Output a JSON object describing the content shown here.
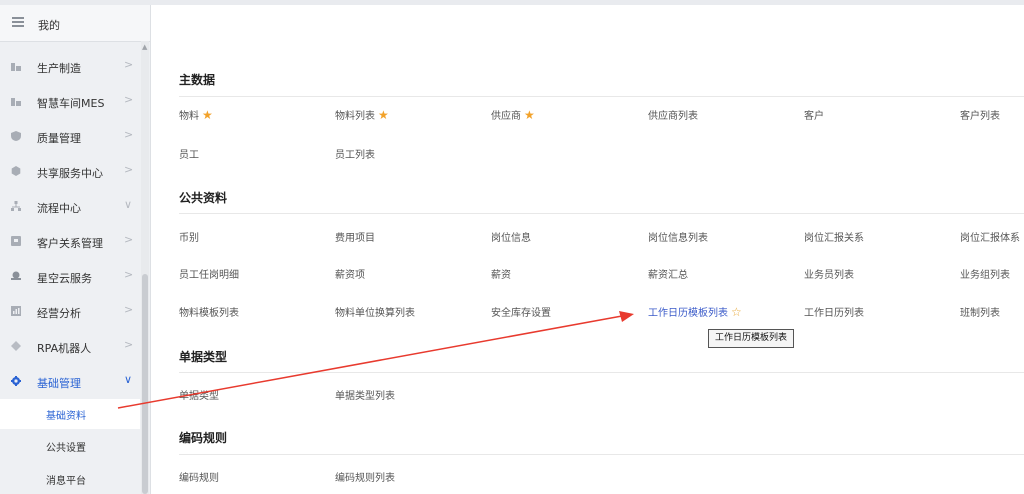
{
  "sidebar": {
    "header": {
      "label": "我的"
    },
    "items": [
      {
        "label": "生产制造",
        "chevron": ">"
      },
      {
        "label": "智慧车间MES",
        "chevron": ">"
      },
      {
        "label": "质量管理",
        "chevron": ">"
      },
      {
        "label": "共享服务中心",
        "chevron": ">"
      },
      {
        "label": "流程中心",
        "chevron": "∨"
      },
      {
        "label": "客户关系管理",
        "chevron": ">"
      },
      {
        "label": "星空云服务",
        "chevron": ">"
      },
      {
        "label": "经营分析",
        "chevron": ">"
      },
      {
        "label": "RPA机器人",
        "chevron": ">"
      },
      {
        "label": "基础管理",
        "chevron": "∨"
      }
    ],
    "sub_items": [
      {
        "label": "基础资料"
      },
      {
        "label": "公共设置"
      },
      {
        "label": "消息平台"
      }
    ]
  },
  "sections": {
    "master": {
      "title": "主数据",
      "links": [
        "物料",
        "物料列表",
        "供应商",
        "供应商列表",
        "客户",
        "客户列表",
        "员工",
        "员工列表"
      ]
    },
    "public": {
      "title": "公共资料",
      "links": [
        "币别",
        "费用项目",
        "岗位信息",
        "岗位信息列表",
        "岗位汇报关系",
        "岗位汇报体系",
        "员工任岗明细",
        "薪资项",
        "薪资",
        "薪资汇总",
        "业务员列表",
        "业务组列表",
        "物料模板列表",
        "物料单位换算列表",
        "安全库存设置",
        "工作日历模板列表",
        "工作日历列表",
        "班制列表"
      ]
    },
    "doc_type": {
      "title": "单据类型",
      "links": [
        "单据类型",
        "单据类型列表"
      ]
    },
    "code_rule": {
      "title": "编码规则",
      "links": [
        "编码规则",
        "编码规则列表"
      ]
    }
  },
  "tooltip": {
    "text": "工作日历模板列表"
  },
  "colors": {
    "accent": "#2a63d4",
    "star": "#f2a22a",
    "arrow": "#e83a2e"
  }
}
